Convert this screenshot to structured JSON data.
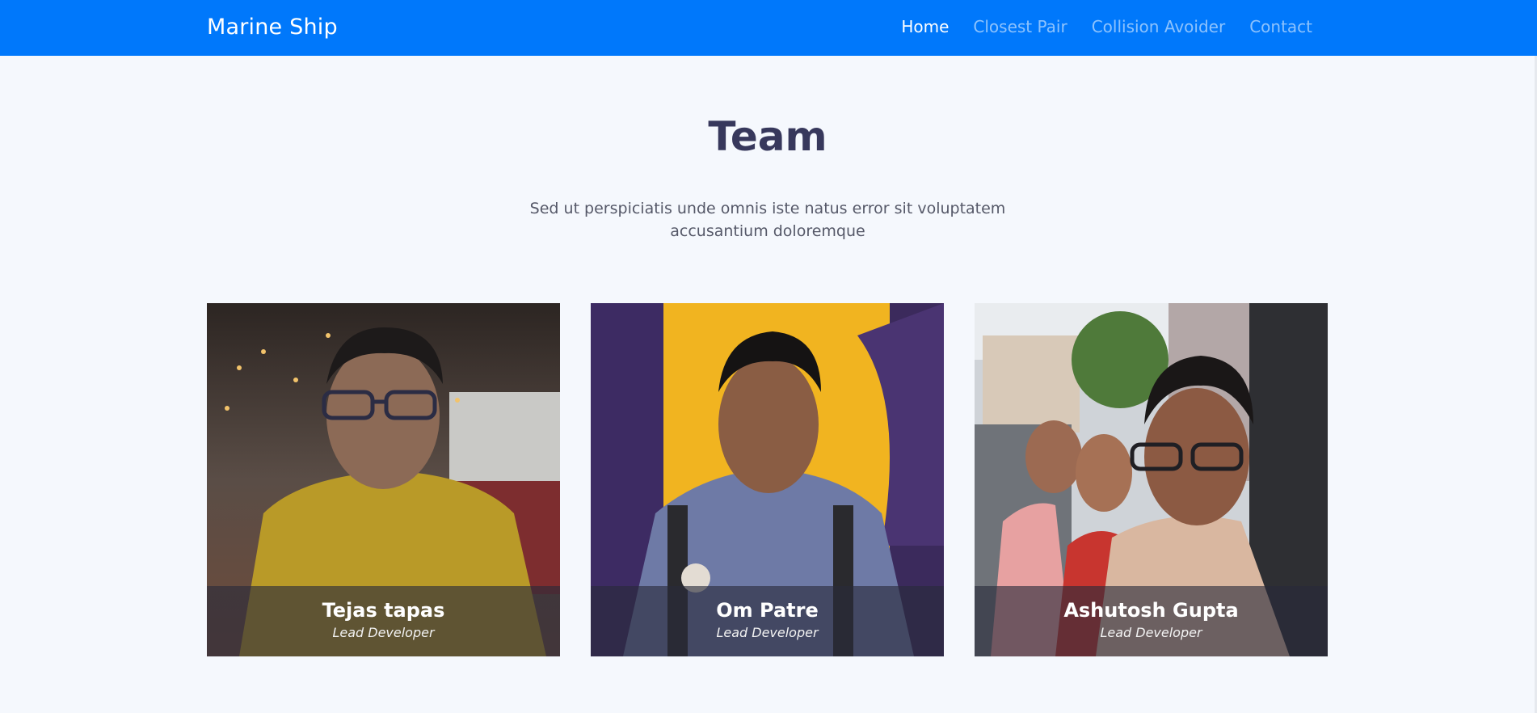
{
  "navbar": {
    "brand": "Marine Ship",
    "links": [
      {
        "label": "Home",
        "active": true
      },
      {
        "label": "Closest Pair",
        "active": false
      },
      {
        "label": "Collision Avoider",
        "active": false
      },
      {
        "label": "Contact",
        "active": false
      }
    ],
    "color": "#0078fb"
  },
  "team": {
    "title": "Team",
    "description": "Sed ut perspiciatis unde omnis iste natus error sit voluptatem accusantium doloremque",
    "members": [
      {
        "name": "Tejas tapas",
        "role": "Lead Developer"
      },
      {
        "name": "Om Patre",
        "role": "Lead Developer"
      },
      {
        "name": "Ashutosh Gupta",
        "role": "Lead Developer"
      }
    ]
  }
}
